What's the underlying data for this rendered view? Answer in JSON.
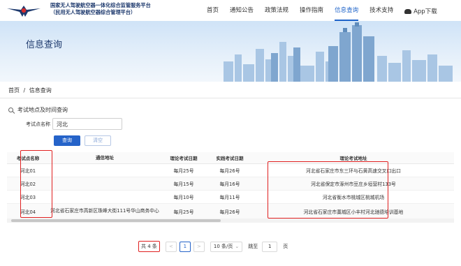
{
  "header": {
    "org_line1": "国家无人驾驶航空器一体化综合监管服务平台",
    "org_line2": "（民用无人驾驶航空器综合管理平台）",
    "nav": [
      {
        "label": "首页"
      },
      {
        "label": "通知公告"
      },
      {
        "label": "政策法规"
      },
      {
        "label": "操作指南"
      },
      {
        "label": "信息查询",
        "active": true
      },
      {
        "label": "技术支持"
      },
      {
        "label": "App下载",
        "icon": "cloud-download-icon"
      }
    ]
  },
  "banner": {
    "title": "信息查询"
  },
  "breadcrumb": {
    "home": "首页",
    "sep": "/",
    "current": "信息查询"
  },
  "search": {
    "section_title": "考试地点及时间查询",
    "field_label": "考试点名称",
    "field_value": "河北",
    "query_label": "查询",
    "clear_label": "清空"
  },
  "table": {
    "headers": [
      "考试点名称",
      "通信地址",
      "理论考试日期",
      "实践考试日期",
      "理论考试地址"
    ],
    "rows": [
      {
        "name": "河北01",
        "address": "",
        "theory_date": "每月25号",
        "practice_date": "每月26号",
        "theory_address": "河北省石家庄市东三环与石黄高速交叉口出口"
      },
      {
        "name": "河北02",
        "address": "",
        "theory_date": "每月15号",
        "practice_date": "每月16号",
        "theory_address": "河北省保定市涿州市豆庄乡垣营村133号"
      },
      {
        "name": "河北03",
        "address": "",
        "theory_date": "每月10号",
        "practice_date": "每月11号",
        "theory_address": "河北省衡水市桃城区桃城机场"
      },
      {
        "name": "河北04",
        "address": "河北省石家庄市高新区珠峰大街111号华山商务中心",
        "theory_date": "每月25号",
        "practice_date": "每月26号",
        "theory_address": "河北省石家庄市藁城区小丰村河北驰德培训基地"
      }
    ]
  },
  "pagination": {
    "total": "共 4 条",
    "prev": "<",
    "current": "1",
    "next": ">",
    "page_size": "10 条/页",
    "jump_label": "跳至",
    "jump_value": "1",
    "page_unit": "页"
  },
  "colors": {
    "accent": "#2563c9",
    "highlight": "#e02020",
    "brand_dark": "#1e3a6e"
  }
}
